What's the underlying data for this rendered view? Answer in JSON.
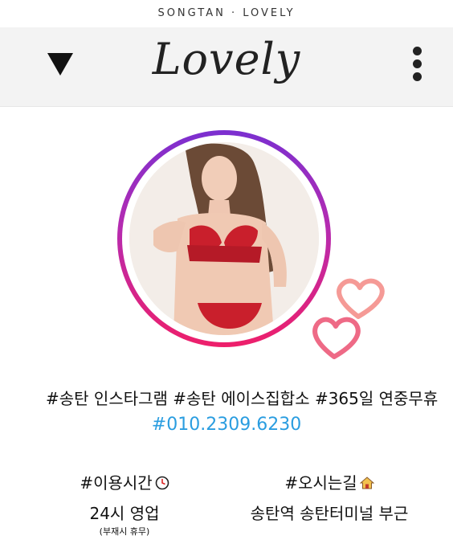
{
  "topbar": {
    "brand_text": "SONGTAN · LOVELY"
  },
  "header": {
    "logo": "Lovely",
    "menu_icon": "triangle-down-icon",
    "more_icon": "vertical-dots-icon"
  },
  "profile": {
    "ring_colors": [
      "#7b2fd0",
      "#b62bb0",
      "#ee1f6a"
    ],
    "hearts_color": "#f07a84"
  },
  "tags": "#송탄 인스타그램 #송탄 에이스집합소 #365일 연중무휴",
  "phone": "#010.2309.6230",
  "hours": {
    "title": "#이용시간",
    "icon": "clock-icon",
    "value": "24시 영업",
    "note": "(부재시 휴무)"
  },
  "location": {
    "title": "#오시는길",
    "icon": "house-icon",
    "value": "송탄역 송탄터미널 부근"
  }
}
